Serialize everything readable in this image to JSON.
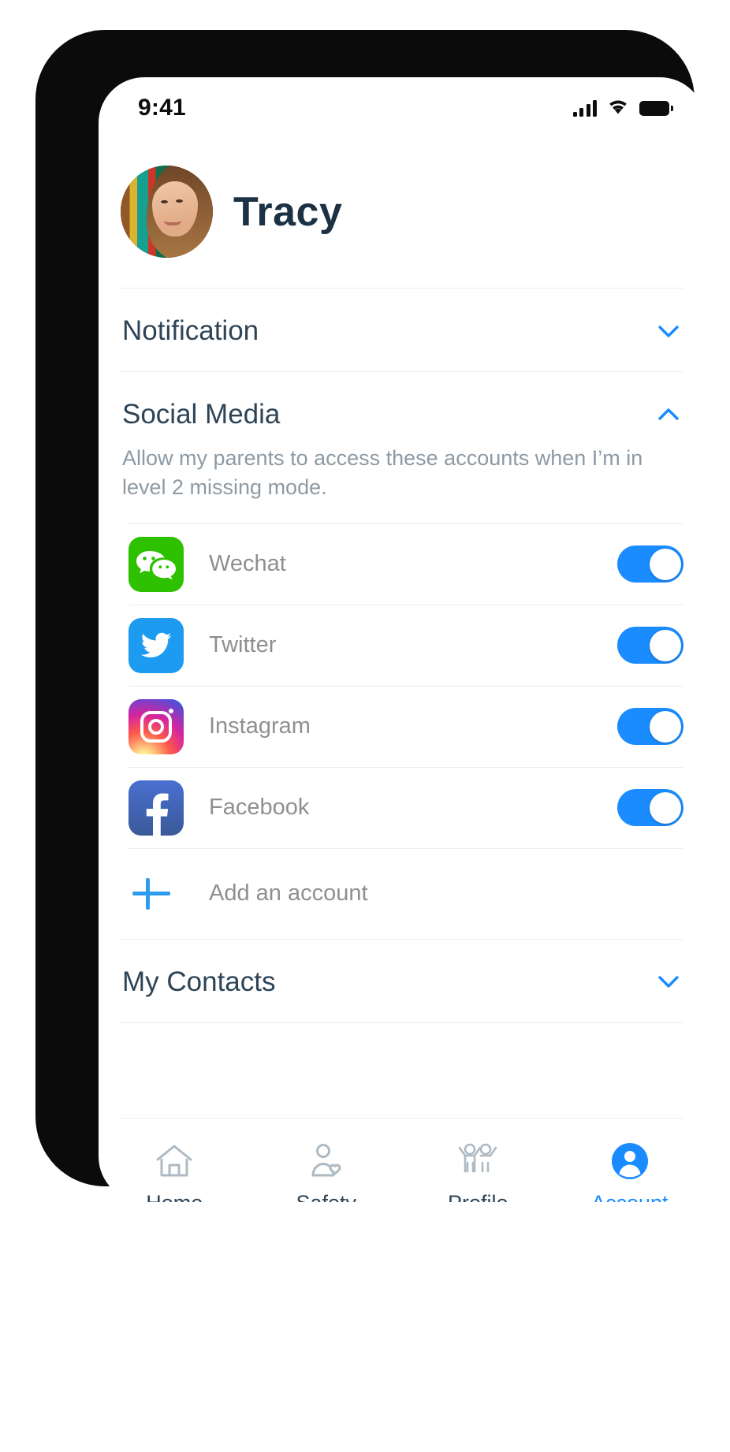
{
  "status_bar": {
    "time": "9:41",
    "signal_icon": "cellular-signal-icon",
    "wifi_icon": "wifi-icon",
    "battery_icon": "battery-full-icon"
  },
  "profile": {
    "name": "Tracy",
    "avatar_icon": "user-avatar-photo"
  },
  "sections": [
    {
      "id": "notification",
      "title": "Notification",
      "expanded": false,
      "chevron_icon": "chevron-down-icon"
    },
    {
      "id": "social-media",
      "title": "Social Media",
      "expanded": true,
      "chevron_icon": "chevron-up-icon",
      "description": "Allow my parents to access these accounts when I’m in level 2 missing mode.",
      "accounts": [
        {
          "name": "Wechat",
          "icon": "wechat-icon",
          "enabled": true
        },
        {
          "name": "Twitter",
          "icon": "twitter-icon",
          "enabled": true
        },
        {
          "name": "Instagram",
          "icon": "instagram-icon",
          "enabled": true
        },
        {
          "name": "Facebook",
          "icon": "facebook-icon",
          "enabled": true
        }
      ],
      "add_account_label": "Add an account",
      "add_account_icon": "plus-icon"
    },
    {
      "id": "my-contacts",
      "title": "My Contacts",
      "expanded": false,
      "chevron_icon": "chevron-down-icon"
    }
  ],
  "tabbar": {
    "items": [
      {
        "label": "Home",
        "icon": "home-icon",
        "active": false
      },
      {
        "label": "Safety",
        "icon": "person-heart-icon",
        "active": false
      },
      {
        "label": "Profile",
        "icon": "two-people-icon",
        "active": false
      },
      {
        "label": "Account",
        "icon": "person-circle-icon",
        "active": true
      }
    ]
  },
  "colors": {
    "accent": "#1a8cff",
    "heading": "#2e4456",
    "muted": "#8f8f8f",
    "description": "#8d9aa4",
    "name": "#1c3144"
  }
}
